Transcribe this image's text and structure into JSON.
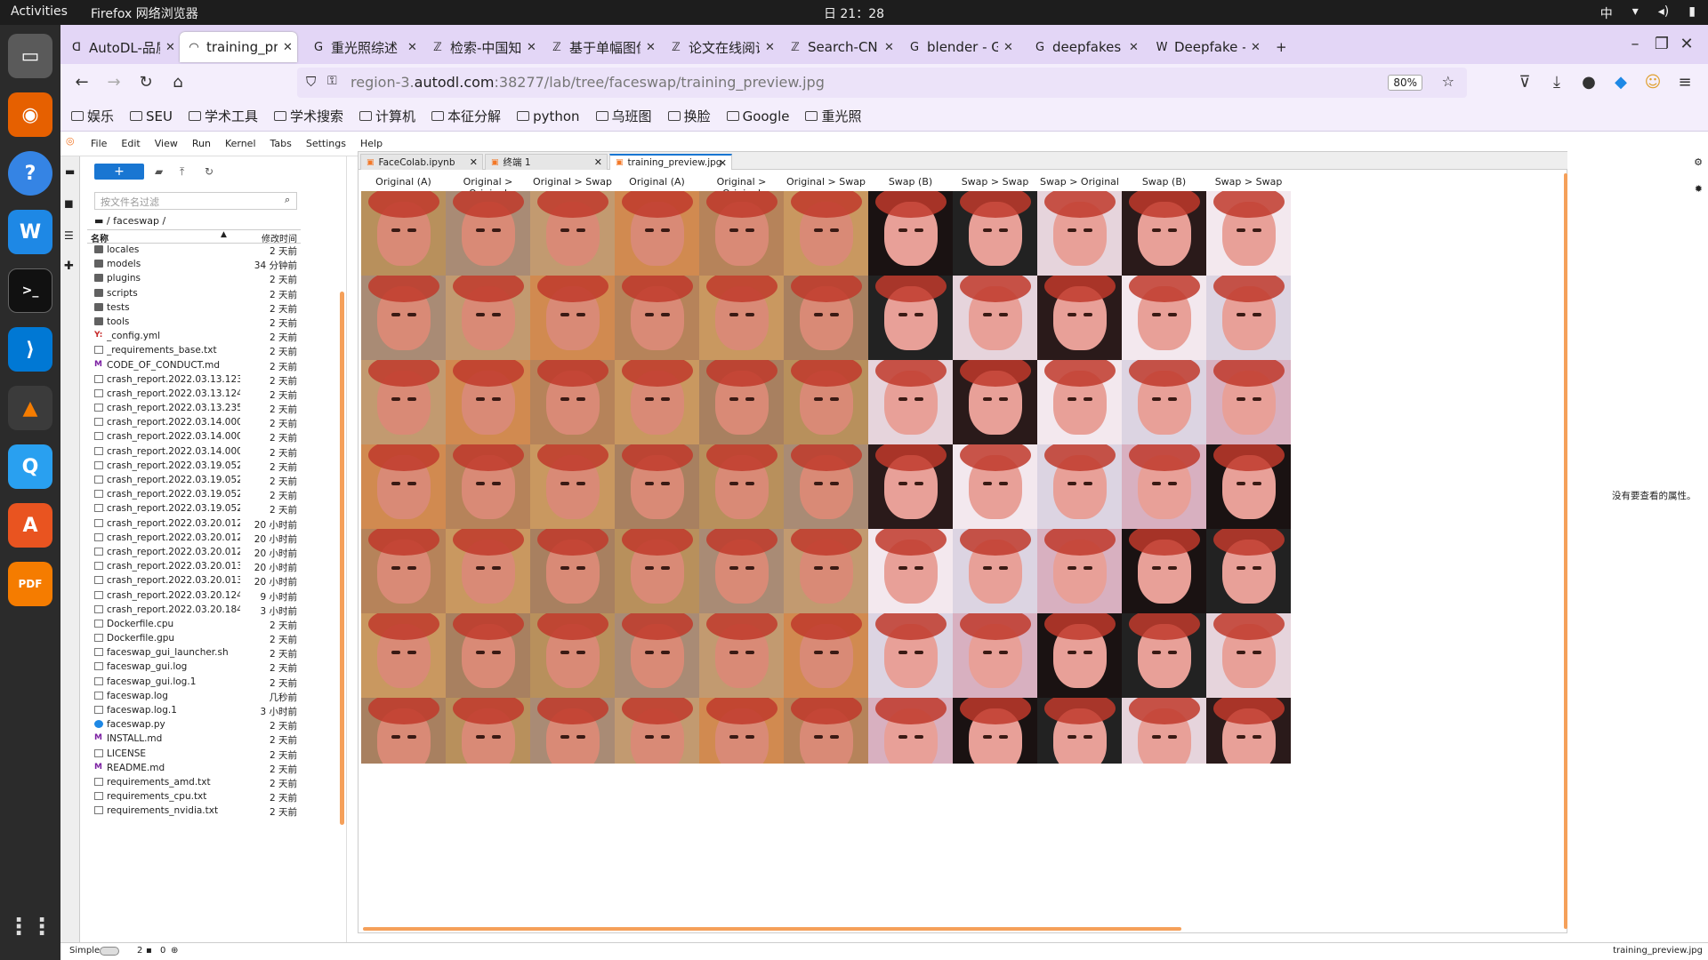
{
  "system_bar": {
    "activities": "Activities",
    "app": "Firefox 网络浏览器",
    "clock": "日 21：28",
    "input_method": "中"
  },
  "browser_tabs": [
    {
      "title": "AutoDL-品质GPU",
      "fav": "ᗡ",
      "active": false
    },
    {
      "title": "training_pre",
      "fav": "◠",
      "active": true
    },
    {
      "title": "重光照综述 - Goo",
      "fav": "G",
      "active": false
    },
    {
      "title": "检索-中国知网",
      "fav": "ℤ",
      "active": false
    },
    {
      "title": "基于单幅图像人脸",
      "fav": "ℤ",
      "active": false
    },
    {
      "title": "论文在线阅读—中",
      "fav": "ℤ",
      "active": false
    },
    {
      "title": "Search-CNKI",
      "fav": "ℤ",
      "active": false
    },
    {
      "title": "blender - Google",
      "fav": "G",
      "active": false
    },
    {
      "title": "deepfakes - Goo",
      "fav": "G",
      "active": false
    },
    {
      "title": "Deepfake - Wikip",
      "fav": "W",
      "active": false
    }
  ],
  "url": {
    "host": "region-3.",
    "domain": "autodl.com",
    "rest": ":38277/lab/tree/faceswap/training_preview.jpg",
    "zoom": "80%"
  },
  "bookmarks": [
    "娱乐",
    "SEU",
    "学术工具",
    "学术搜索",
    "计算机",
    "本征分解",
    "python",
    "乌班图",
    "换脸",
    "Google",
    "重光照"
  ],
  "jupyter_menu": [
    "File",
    "Edit",
    "View",
    "Run",
    "Kernel",
    "Tabs",
    "Settings",
    "Help"
  ],
  "filebrowser": {
    "new_label": "+",
    "filter_placeholder": "按文件名过滤",
    "breadcrumb": "/ faceswap /",
    "col_name": "名称",
    "col_time": "修改时间",
    "files": [
      {
        "name": "locales",
        "time": "2 天前",
        "type": "folder"
      },
      {
        "name": "models",
        "time": "34 分钟前",
        "type": "folder"
      },
      {
        "name": "plugins",
        "time": "2 天前",
        "type": "folder"
      },
      {
        "name": "scripts",
        "time": "2 天前",
        "type": "folder"
      },
      {
        "name": "tests",
        "time": "2 天前",
        "type": "folder"
      },
      {
        "name": "tools",
        "time": "2 天前",
        "type": "folder"
      },
      {
        "name": "_config.yml",
        "time": "2 天前",
        "type": "yml"
      },
      {
        "name": "_requirements_base.txt",
        "time": "2 天前",
        "type": "file"
      },
      {
        "name": "CODE_OF_CONDUCT.md",
        "time": "2 天前",
        "type": "md"
      },
      {
        "name": "crash_report.2022.03.13.123…",
        "time": "2 天前",
        "type": "file"
      },
      {
        "name": "crash_report.2022.03.13.124…",
        "time": "2 天前",
        "type": "file"
      },
      {
        "name": "crash_report.2022.03.13.235…",
        "time": "2 天前",
        "type": "file"
      },
      {
        "name": "crash_report.2022.03.14.000…",
        "time": "2 天前",
        "type": "file"
      },
      {
        "name": "crash_report.2022.03.14.000…",
        "time": "2 天前",
        "type": "file"
      },
      {
        "name": "crash_report.2022.03.14.000…",
        "time": "2 天前",
        "type": "file"
      },
      {
        "name": "crash_report.2022.03.19.052…",
        "time": "2 天前",
        "type": "file"
      },
      {
        "name": "crash_report.2022.03.19.052…",
        "time": "2 天前",
        "type": "file"
      },
      {
        "name": "crash_report.2022.03.19.052…",
        "time": "2 天前",
        "type": "file"
      },
      {
        "name": "crash_report.2022.03.19.052…",
        "time": "2 天前",
        "type": "file"
      },
      {
        "name": "crash_report.2022.03.20.012…",
        "time": "20 小时前",
        "type": "file"
      },
      {
        "name": "crash_report.2022.03.20.012…",
        "time": "20 小时前",
        "type": "file"
      },
      {
        "name": "crash_report.2022.03.20.012…",
        "time": "20 小时前",
        "type": "file"
      },
      {
        "name": "crash_report.2022.03.20.013…",
        "time": "20 小时前",
        "type": "file"
      },
      {
        "name": "crash_report.2022.03.20.013…",
        "time": "20 小时前",
        "type": "file"
      },
      {
        "name": "crash_report.2022.03.20.124…",
        "time": "9 小时前",
        "type": "file"
      },
      {
        "name": "crash_report.2022.03.20.184…",
        "time": "3 小时前",
        "type": "file"
      },
      {
        "name": "Dockerfile.cpu",
        "time": "2 天前",
        "type": "file"
      },
      {
        "name": "Dockerfile.gpu",
        "time": "2 天前",
        "type": "file"
      },
      {
        "name": "faceswap_gui_launcher.sh",
        "time": "2 天前",
        "type": "file"
      },
      {
        "name": "faceswap_gui.log",
        "time": "2 天前",
        "type": "file"
      },
      {
        "name": "faceswap_gui.log.1",
        "time": "2 天前",
        "type": "file"
      },
      {
        "name": "faceswap.log",
        "time": "几秒前",
        "type": "file"
      },
      {
        "name": "faceswap.log.1",
        "time": "3 小时前",
        "type": "file"
      },
      {
        "name": "faceswap.py",
        "time": "2 天前",
        "type": "py"
      },
      {
        "name": "INSTALL.md",
        "time": "2 天前",
        "type": "md"
      },
      {
        "name": "LICENSE",
        "time": "2 天前",
        "type": "file"
      },
      {
        "name": "README.md",
        "time": "2 天前",
        "type": "md"
      },
      {
        "name": "requirements_amd.txt",
        "time": "2 天前",
        "type": "file"
      },
      {
        "name": "requirements_cpu.txt",
        "time": "2 天前",
        "type": "file"
      },
      {
        "name": "requirements_nvidia.txt",
        "time": "2 天前",
        "type": "file"
      }
    ]
  },
  "doc_tabs": [
    {
      "label": "FaceColab.ipynb",
      "active": false
    },
    {
      "label": "终端 1",
      "active": false
    },
    {
      "label": "training_preview.jpg",
      "active": true
    }
  ],
  "preview": {
    "columns": [
      "Original (A)",
      "Original > Original",
      "Original > Swap",
      "Original (A)",
      "Original > Original",
      "Original > Swap",
      "Swap (B)",
      "Swap > Swap",
      "Swap > Original",
      "Swap (B)",
      "Swap > Swap"
    ],
    "rows": 7
  },
  "right_panel": {
    "message": "没有要查看的属性。"
  },
  "status": {
    "mode": "Simple",
    "kernels": "2",
    "terminals": "0",
    "filename": "training_preview.jpg"
  }
}
